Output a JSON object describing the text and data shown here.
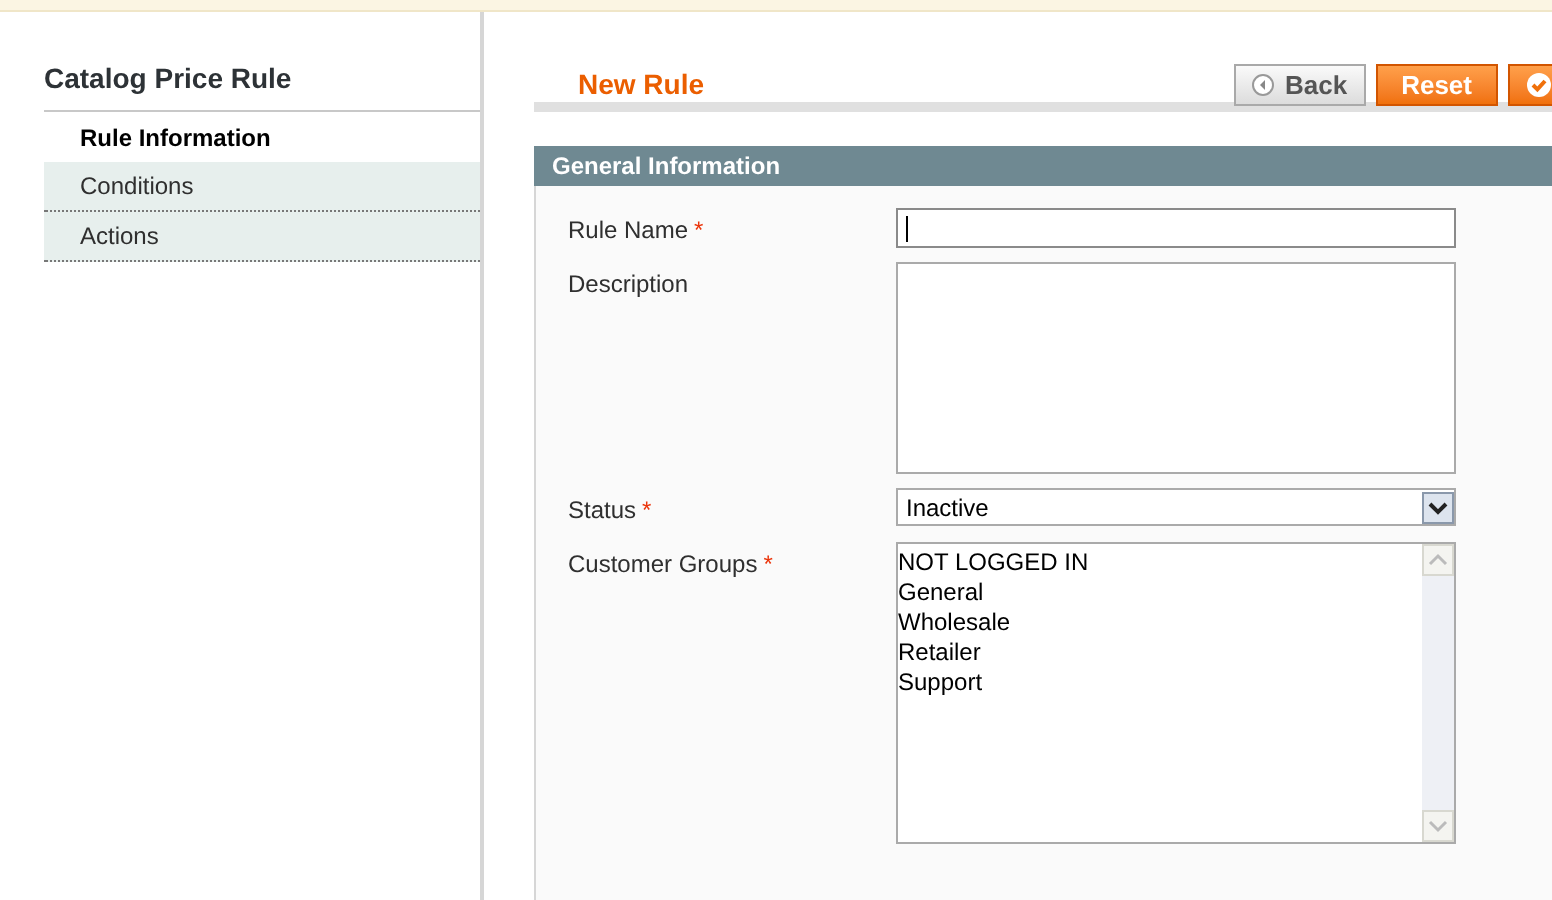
{
  "sidebar": {
    "title": "Catalog Price Rule",
    "tabs": [
      {
        "label": "Rule Information",
        "selected": true
      },
      {
        "label": "Conditions",
        "selected": false
      },
      {
        "label": "Actions",
        "selected": false
      }
    ]
  },
  "header": {
    "title": "New Rule",
    "buttons": [
      {
        "kind": "back",
        "label": "Back"
      },
      {
        "kind": "primary",
        "label": "Reset"
      },
      {
        "kind": "check"
      }
    ]
  },
  "section": {
    "title": "General Information",
    "fields": [
      {
        "kind": "text",
        "label": "Rule Name",
        "required_mark": "*",
        "focused": true
      },
      {
        "kind": "textarea",
        "label": "Description"
      },
      {
        "kind": "select",
        "label": "Status",
        "required_mark": "*",
        "value": "Inactive"
      },
      {
        "kind": "multiselect",
        "label": "Customer Groups",
        "required_mark": "*",
        "options": [
          "NOT LOGGED IN",
          "General",
          "Wholesale",
          "Retailer",
          "Support"
        ]
      }
    ]
  }
}
